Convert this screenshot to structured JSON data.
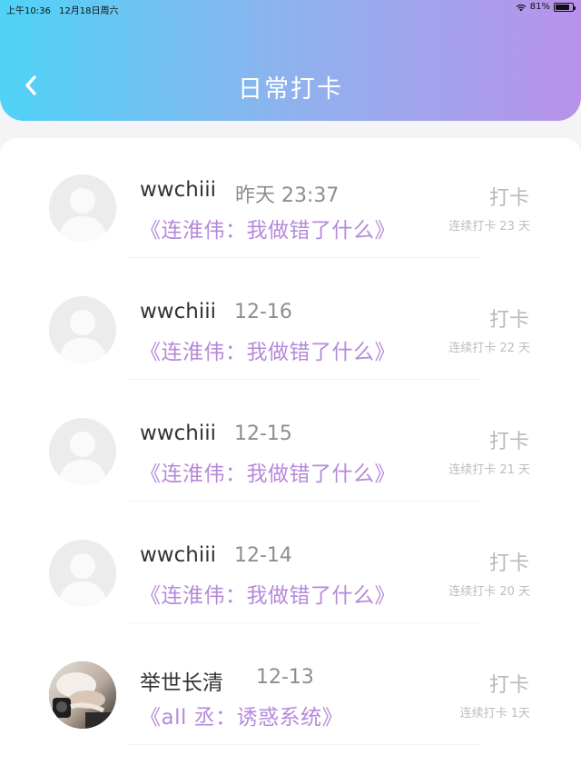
{
  "status_bar": {
    "time": "上午10:36",
    "date": "12月18日周六",
    "battery": "81%",
    "battery_level": 0.81
  },
  "header": {
    "title": "日常打卡",
    "back_icon": "chevron-left-icon"
  },
  "colors": {
    "gradient_start": "#4fd3f7",
    "gradient_end": "#b892ea",
    "book_title": "#b58ad9"
  },
  "checkins": [
    {
      "name": "wwchiii",
      "date": "昨天 23:37",
      "book": "《连淮伟：我做错了什么》",
      "action": "打卡",
      "streak": "连续打卡 23 天",
      "avatar": "default-avatar-icon"
    },
    {
      "name": "wwchiii",
      "date": "12-16",
      "book": "《连淮伟：我做错了什么》",
      "action": "打卡",
      "streak": "连续打卡 22 天",
      "avatar": "default-avatar-icon"
    },
    {
      "name": "wwchiii",
      "date": "12-15",
      "book": "《连淮伟：我做错了什么》",
      "action": "打卡",
      "streak": "连续打卡 21 天",
      "avatar": "default-avatar-icon"
    },
    {
      "name": "wwchiii",
      "date": "12-14",
      "book": "《连淮伟：我做错了什么》",
      "action": "打卡",
      "streak": "连续打卡 20 天",
      "avatar": "default-avatar-icon"
    },
    {
      "name": "举世长清",
      "date": "12-13",
      "book": "《all 丞：诱惑系统》",
      "action": "打卡",
      "streak": "连续打卡 1天",
      "avatar": "photo-avatar"
    }
  ]
}
